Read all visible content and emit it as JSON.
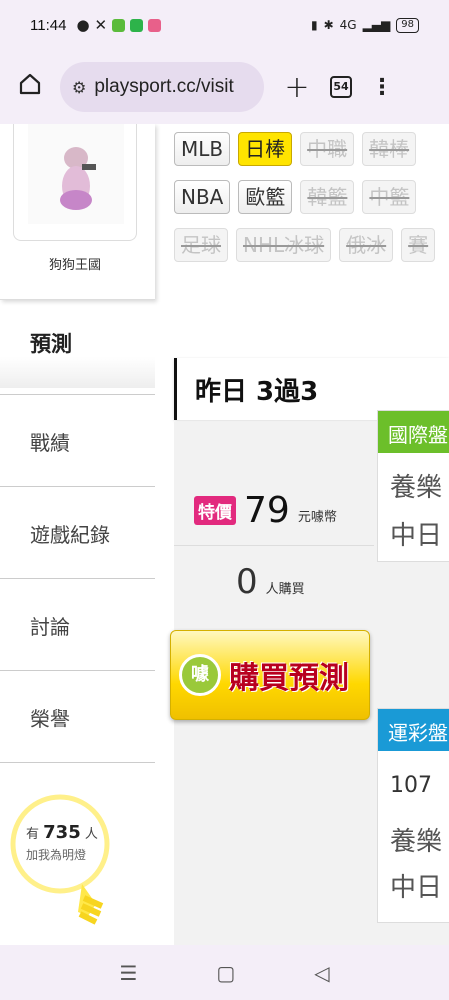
{
  "status_bar": {
    "time": "11:44",
    "battery": "98",
    "network": "4G"
  },
  "browser": {
    "url": "playsport.cc/visit",
    "tab_count": "54"
  },
  "sidebar": {
    "user_name": "狗狗王國",
    "active_item": "預測",
    "items": [
      {
        "label": "戰績"
      },
      {
        "label": "遊戲紀錄"
      },
      {
        "label": "討論"
      },
      {
        "label": "榮譽"
      }
    ],
    "fans": {
      "prefix": "有",
      "count": "735",
      "suffix": "人",
      "caption": "加我為明燈"
    }
  },
  "tags": {
    "row1": [
      "MLB",
      "日棒",
      "中職",
      "韓棒"
    ],
    "row2": [
      "NBA",
      "歐籃",
      "韓籃",
      "中籃"
    ],
    "row3": [
      "足球",
      "NHL冰球",
      "俄冰",
      "賽"
    ]
  },
  "result": {
    "title": "昨日 3過3",
    "price_badge": "特價",
    "price": "79",
    "price_unit": "元噱幣",
    "buyers": "0",
    "buyers_label": "人購買",
    "buy_icon": "噱",
    "buy_button": "購買預測"
  },
  "panels": {
    "international": {
      "header": "國際盤",
      "row1": "養樂",
      "row2": "中日"
    },
    "sports_lottery": {
      "header": "運彩盤",
      "value": "107",
      "row1": "養樂",
      "row2": "中日"
    }
  },
  "colors": {
    "accent_yellow": "#ffe400",
    "badge_pink": "#e22a7e",
    "panel_green": "#6cbf2a",
    "panel_blue": "#1a9ad6"
  }
}
